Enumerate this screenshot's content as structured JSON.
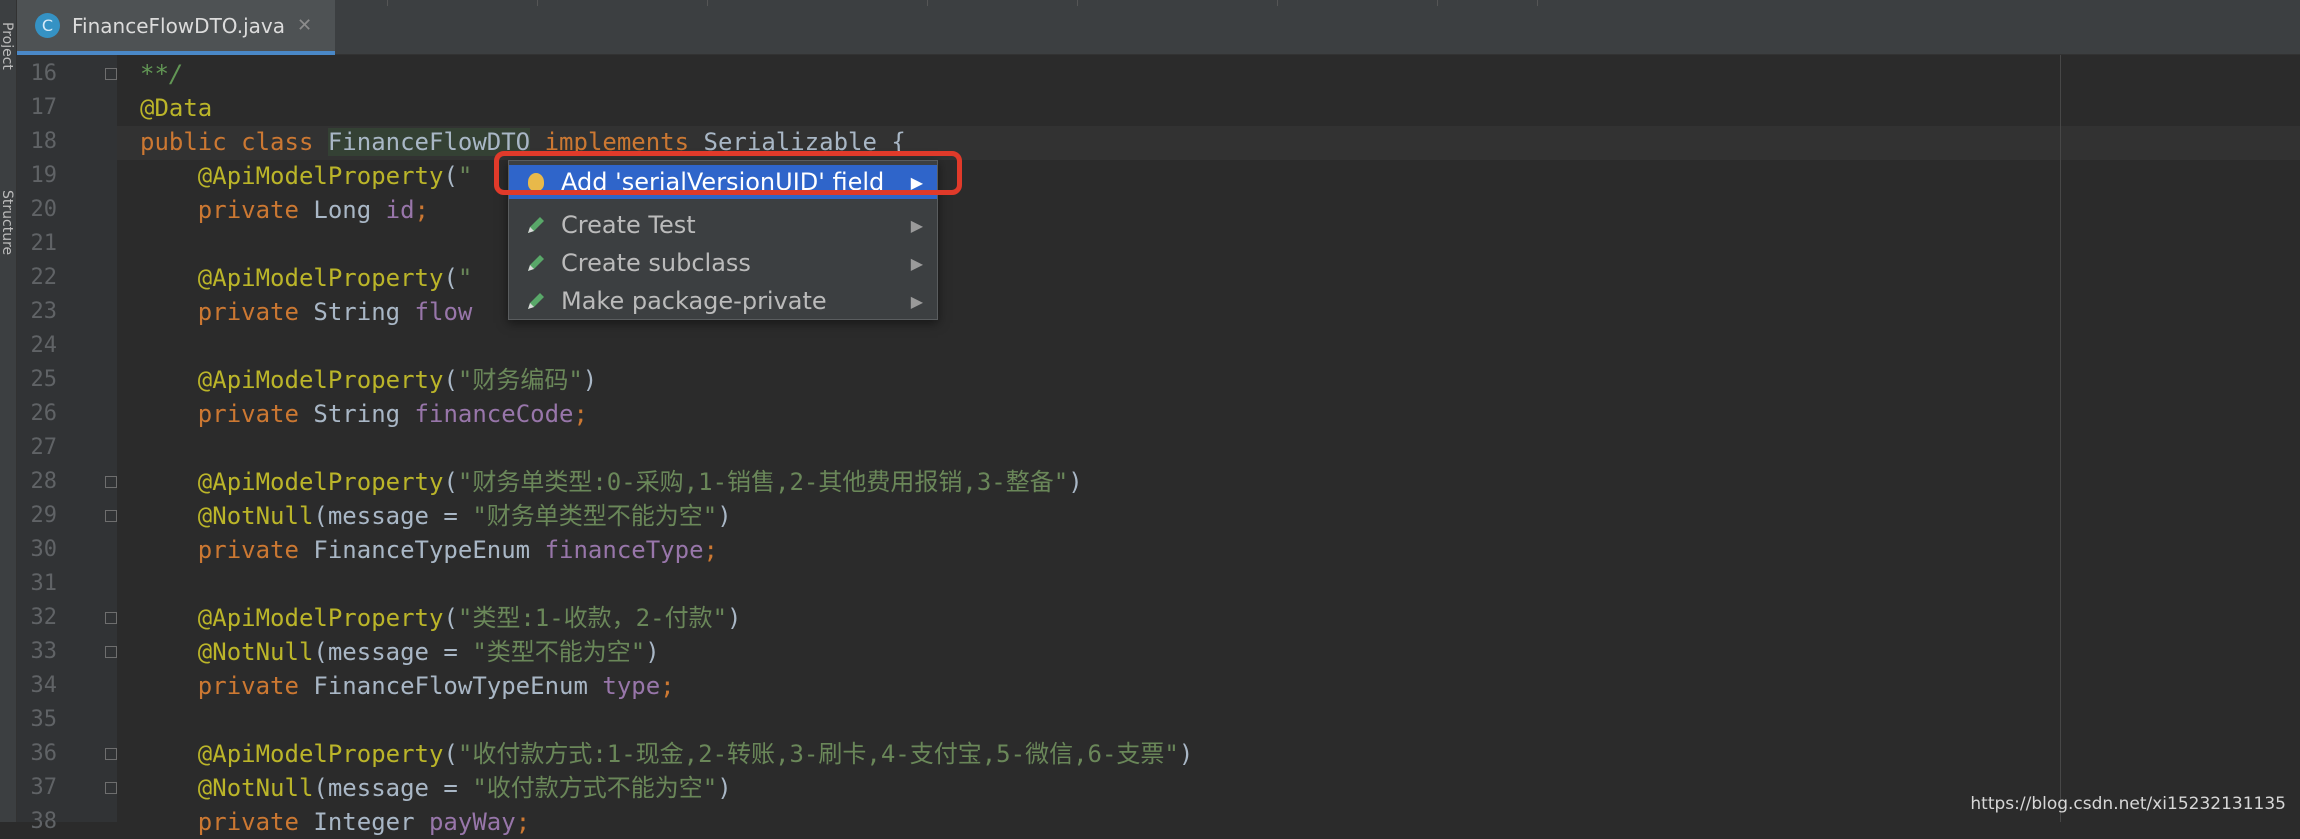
{
  "left_strip": {
    "labels": [
      "Project",
      "Structure"
    ]
  },
  "tabs": [
    {
      "title": "FinanceFlowDTO.java",
      "icon": "java-class-icon",
      "icon_letter": "C",
      "close": "✕"
    }
  ],
  "editor": {
    "lines": [
      {
        "num": "16",
        "fold": true,
        "tokens": [
          [
            "com",
            "**/"
          ]
        ]
      },
      {
        "num": "17",
        "fold": false,
        "tokens": [
          [
            "ann",
            "@Data"
          ]
        ]
      },
      {
        "num": "18",
        "fold": false,
        "tokens": [
          [
            "kw",
            "public class "
          ],
          [
            "cls",
            "FinanceFlowDTO"
          ],
          [
            "kw",
            " implements "
          ],
          [
            "txt",
            "Serializable {"
          ]
        ]
      },
      {
        "num": "19",
        "fold": false,
        "tokens": [
          [
            "txt",
            "    "
          ],
          [
            "ann",
            "@ApiModelProperty"
          ],
          [
            "txt",
            "("
          ],
          [
            "str",
            "\""
          ]
        ]
      },
      {
        "num": "20",
        "fold": false,
        "tokens": [
          [
            "kw",
            "    private "
          ],
          [
            "txt",
            "Long "
          ],
          [
            "fld",
            "id"
          ],
          [
            "kw",
            ";"
          ]
        ]
      },
      {
        "num": "21",
        "fold": false,
        "tokens": []
      },
      {
        "num": "22",
        "fold": false,
        "tokens": [
          [
            "txt",
            "    "
          ],
          [
            "ann",
            "@ApiModelProperty"
          ],
          [
            "txt",
            "("
          ],
          [
            "str",
            "\""
          ]
        ]
      },
      {
        "num": "23",
        "fold": false,
        "tokens": [
          [
            "kw",
            "    private "
          ],
          [
            "txt",
            "String "
          ],
          [
            "fld",
            "flow"
          ]
        ]
      },
      {
        "num": "24",
        "fold": false,
        "tokens": []
      },
      {
        "num": "25",
        "fold": false,
        "tokens": [
          [
            "txt",
            "    "
          ],
          [
            "ann",
            "@ApiModelProperty"
          ],
          [
            "txt",
            "("
          ],
          [
            "str",
            "\"财务编码\""
          ],
          [
            "txt",
            ")"
          ]
        ]
      },
      {
        "num": "26",
        "fold": false,
        "tokens": [
          [
            "kw",
            "    private "
          ],
          [
            "txt",
            "String "
          ],
          [
            "fld",
            "financeCode"
          ],
          [
            "kw",
            ";"
          ]
        ]
      },
      {
        "num": "27",
        "fold": false,
        "tokens": []
      },
      {
        "num": "28",
        "fold": true,
        "tokens": [
          [
            "txt",
            "    "
          ],
          [
            "ann",
            "@ApiModelProperty"
          ],
          [
            "txt",
            "("
          ],
          [
            "str",
            "\"财务单类型:0-采购,1-销售,2-其他费用报销,3-整备\""
          ],
          [
            "txt",
            ")"
          ]
        ]
      },
      {
        "num": "29",
        "fold": true,
        "tokens": [
          [
            "txt",
            "    "
          ],
          [
            "ann",
            "@NotNull"
          ],
          [
            "txt",
            "(message = "
          ],
          [
            "str",
            "\"财务单类型不能为空\""
          ],
          [
            "txt",
            ")"
          ]
        ]
      },
      {
        "num": "30",
        "fold": false,
        "tokens": [
          [
            "kw",
            "    private "
          ],
          [
            "txt",
            "FinanceTypeEnum "
          ],
          [
            "fld",
            "financeType"
          ],
          [
            "kw",
            ";"
          ]
        ]
      },
      {
        "num": "31",
        "fold": false,
        "tokens": []
      },
      {
        "num": "32",
        "fold": true,
        "tokens": [
          [
            "txt",
            "    "
          ],
          [
            "ann",
            "@ApiModelProperty"
          ],
          [
            "txt",
            "("
          ],
          [
            "str",
            "\"类型:1-收款，2-付款\""
          ],
          [
            "txt",
            ")"
          ]
        ]
      },
      {
        "num": "33",
        "fold": true,
        "tokens": [
          [
            "txt",
            "    "
          ],
          [
            "ann",
            "@NotNull"
          ],
          [
            "txt",
            "(message = "
          ],
          [
            "str",
            "\"类型不能为空\""
          ],
          [
            "txt",
            ")"
          ]
        ]
      },
      {
        "num": "34",
        "fold": false,
        "tokens": [
          [
            "kw",
            "    private "
          ],
          [
            "txt",
            "FinanceFlowTypeEnum "
          ],
          [
            "fld",
            "type"
          ],
          [
            "kw",
            ";"
          ]
        ]
      },
      {
        "num": "35",
        "fold": false,
        "tokens": []
      },
      {
        "num": "36",
        "fold": true,
        "tokens": [
          [
            "txt",
            "    "
          ],
          [
            "ann",
            "@ApiModelProperty"
          ],
          [
            "txt",
            "("
          ],
          [
            "str",
            "\"收付款方式:1-现金,2-转账,3-刷卡,4-支付宝,5-微信,6-支票\""
          ],
          [
            "txt",
            ")"
          ]
        ]
      },
      {
        "num": "37",
        "fold": true,
        "tokens": [
          [
            "txt",
            "    "
          ],
          [
            "ann",
            "@NotNull"
          ],
          [
            "txt",
            "(message = "
          ],
          [
            "str",
            "\"收付款方式不能为空\""
          ],
          [
            "txt",
            ")"
          ]
        ]
      },
      {
        "num": "38",
        "fold": false,
        "tokens": [
          [
            "kw",
            "    private "
          ],
          [
            "txt",
            "Integer "
          ],
          [
            "fld",
            "payWay"
          ],
          [
            "kw",
            ";"
          ]
        ]
      }
    ]
  },
  "popup": {
    "items": [
      {
        "label": "Add 'serialVersionUID' field",
        "icon": "lightbulb-icon",
        "selected": true,
        "arrow": "▶"
      },
      {
        "label": "Create Test",
        "icon": "pencil-icon",
        "selected": false,
        "arrow": "▶"
      },
      {
        "label": "Create subclass",
        "icon": "pencil-icon",
        "selected": false,
        "arrow": "▶"
      },
      {
        "label": "Make package-private",
        "icon": "pencil-icon",
        "selected": false,
        "arrow": "▶"
      }
    ]
  },
  "watermark": "https://blog.csdn.net/xi15232131135",
  "colors": {
    "editor_bg": "#2b2b2b",
    "keyword": "#cc7832",
    "annotation": "#bbb529",
    "string": "#6a8759",
    "field": "#9876aa",
    "selection": "#2f65ca",
    "highlight_box": "#e03a2a"
  }
}
